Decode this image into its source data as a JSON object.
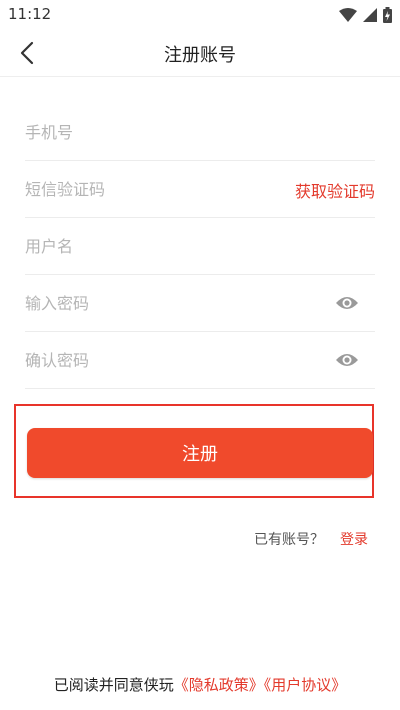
{
  "status_bar": {
    "time": "11:12",
    "icons": [
      "wifi-icon",
      "signal-icon",
      "battery-charging-icon"
    ]
  },
  "header": {
    "title": "注册账号",
    "back_icon": "chevron-left-icon"
  },
  "form": {
    "phone_placeholder": "手机号",
    "sms_code_placeholder": "短信验证码",
    "get_code_label": "获取验证码",
    "username_placeholder": "用户名",
    "password_placeholder": "输入密码",
    "confirm_password_placeholder": "确认密码",
    "visibility_icon": "eye-icon"
  },
  "register_label": "注册",
  "login_prompt": {
    "text": "已有账号？",
    "link": "登录"
  },
  "agreement": {
    "prefix": "已阅读并同意侠玩",
    "privacy": "《隐私政策》",
    "terms": "《用户协议》"
  },
  "colors": {
    "accent": "#e33a2c",
    "button": "#f04a2c",
    "highlight_border": "#e8342a"
  }
}
